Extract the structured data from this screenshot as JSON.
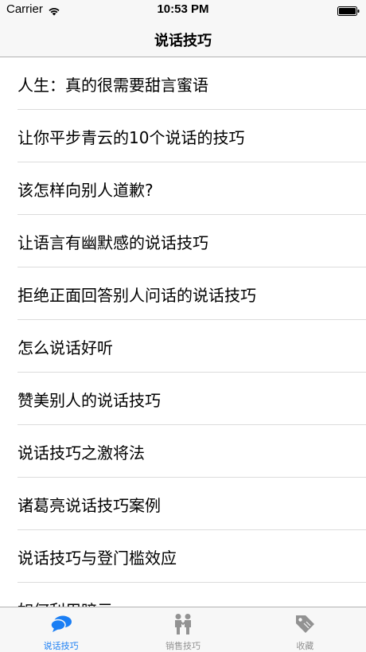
{
  "status_bar": {
    "carrier": "Carrier",
    "time": "10:53 PM",
    "wifi_icon": "wifi-icon",
    "battery_icon": "battery-icon"
  },
  "nav": {
    "title": "说话技巧"
  },
  "list": {
    "items": [
      {
        "label": "人生：真的很需要甜言蜜语"
      },
      {
        "label": "让你平步青云的10个说话的技巧"
      },
      {
        "label": "该怎样向别人道歉?"
      },
      {
        "label": "让语言有幽默感的说话技巧"
      },
      {
        "label": "拒绝正面回答别人问话的说话技巧"
      },
      {
        "label": "怎么说话好听"
      },
      {
        "label": "赞美别人的说话技巧"
      },
      {
        "label": "说话技巧之激将法"
      },
      {
        "label": "诸葛亮说话技巧案例"
      },
      {
        "label": "说话技巧与登门槛效应"
      },
      {
        "label": "如何利用暗示..."
      }
    ]
  },
  "tab_bar": {
    "accent_color": "#1a7ef4",
    "inactive_color": "#929292",
    "tabs": [
      {
        "label": "说话技巧",
        "icon": "speech-bubbles-icon",
        "active": true
      },
      {
        "label": "销售技巧",
        "icon": "handshake-people-icon",
        "active": false
      },
      {
        "label": "收藏",
        "icon": "tag-icon",
        "active": false
      }
    ]
  }
}
